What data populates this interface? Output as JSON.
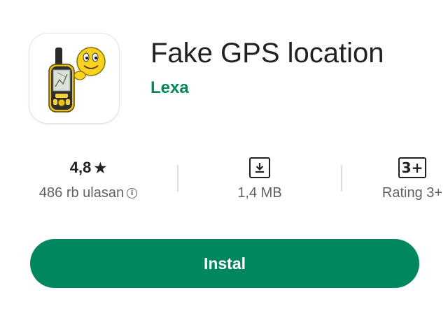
{
  "app": {
    "title": "Fake GPS location",
    "developer": "Lexa",
    "icon": "gps-device-smiley-icon"
  },
  "stats": {
    "rating": {
      "value": "4,8",
      "star": "★",
      "label": "486 rb ulasan",
      "info_glyph": "i"
    },
    "size": {
      "icon": "download-icon",
      "label": "1,4 MB"
    },
    "content_rating": {
      "badge": "3+",
      "label": "Rating 3+"
    }
  },
  "install": {
    "label": "Instal"
  },
  "colors": {
    "accent": "#01875f",
    "text": "#202124",
    "secondary_text": "#5f6368",
    "divider": "#dadce0"
  }
}
